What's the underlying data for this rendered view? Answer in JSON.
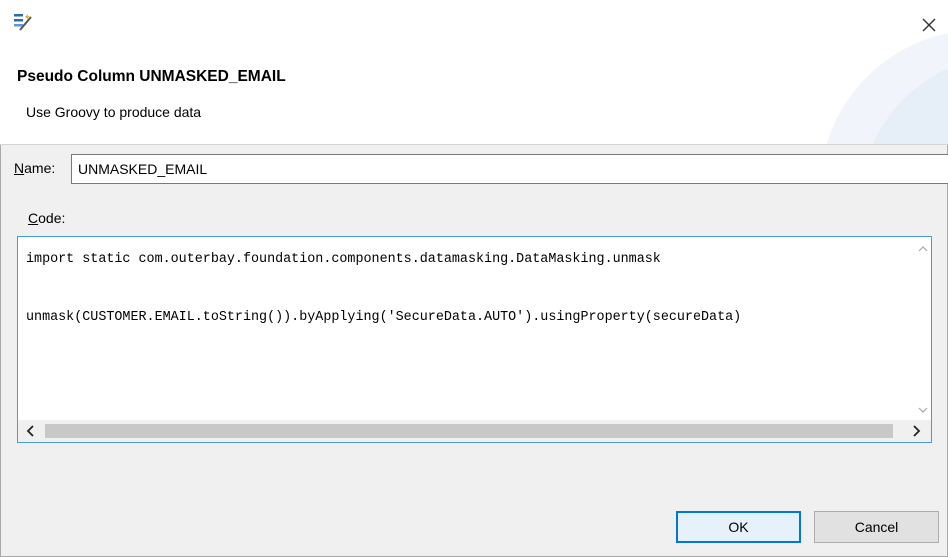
{
  "dialog": {
    "title": "Pseudo Column UNMASKED_EMAIL",
    "description": "Use Groovy to produce data"
  },
  "name_field": {
    "label_mnemonic": "N",
    "label_rest": "ame:",
    "value": "UNMASKED_EMAIL"
  },
  "code_field": {
    "label_mnemonic": "C",
    "label_rest": "ode:",
    "lines": [
      "import static com.outerbay.foundation.components.datamasking.DataMasking.unmask",
      "",
      "unmask(CUSTOMER.EMAIL.toString()).byApplying('SecureData.AUTO').usingProperty(secureData)"
    ]
  },
  "buttons": {
    "ok": "OK",
    "cancel": "Cancel"
  },
  "icons": {
    "app": "wizard-wand-icon",
    "close": "close-icon",
    "scroll_up": "chevron-up-icon",
    "scroll_down": "chevron-down-icon",
    "scroll_left": "chevron-left-icon",
    "scroll_right": "chevron-right-icon"
  },
  "colors": {
    "accent": "#0078d7",
    "focus_border": "#4a9ad6",
    "background": "#f0f0f0"
  }
}
